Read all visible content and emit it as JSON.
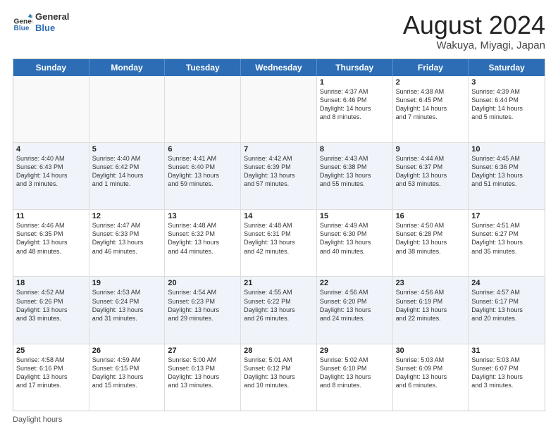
{
  "header": {
    "logo_line1": "General",
    "logo_line2": "Blue",
    "title": "August 2024",
    "subtitle": "Wakuya, Miyagi, Japan"
  },
  "days_of_week": [
    "Sunday",
    "Monday",
    "Tuesday",
    "Wednesday",
    "Thursday",
    "Friday",
    "Saturday"
  ],
  "weeks": [
    [
      {
        "day": "",
        "info": ""
      },
      {
        "day": "",
        "info": ""
      },
      {
        "day": "",
        "info": ""
      },
      {
        "day": "",
        "info": ""
      },
      {
        "day": "1",
        "info": "Sunrise: 4:37 AM\nSunset: 6:46 PM\nDaylight: 14 hours\nand 8 minutes."
      },
      {
        "day": "2",
        "info": "Sunrise: 4:38 AM\nSunset: 6:45 PM\nDaylight: 14 hours\nand 7 minutes."
      },
      {
        "day": "3",
        "info": "Sunrise: 4:39 AM\nSunset: 6:44 PM\nDaylight: 14 hours\nand 5 minutes."
      }
    ],
    [
      {
        "day": "4",
        "info": "Sunrise: 4:40 AM\nSunset: 6:43 PM\nDaylight: 14 hours\nand 3 minutes."
      },
      {
        "day": "5",
        "info": "Sunrise: 4:40 AM\nSunset: 6:42 PM\nDaylight: 14 hours\nand 1 minute."
      },
      {
        "day": "6",
        "info": "Sunrise: 4:41 AM\nSunset: 6:40 PM\nDaylight: 13 hours\nand 59 minutes."
      },
      {
        "day": "7",
        "info": "Sunrise: 4:42 AM\nSunset: 6:39 PM\nDaylight: 13 hours\nand 57 minutes."
      },
      {
        "day": "8",
        "info": "Sunrise: 4:43 AM\nSunset: 6:38 PM\nDaylight: 13 hours\nand 55 minutes."
      },
      {
        "day": "9",
        "info": "Sunrise: 4:44 AM\nSunset: 6:37 PM\nDaylight: 13 hours\nand 53 minutes."
      },
      {
        "day": "10",
        "info": "Sunrise: 4:45 AM\nSunset: 6:36 PM\nDaylight: 13 hours\nand 51 minutes."
      }
    ],
    [
      {
        "day": "11",
        "info": "Sunrise: 4:46 AM\nSunset: 6:35 PM\nDaylight: 13 hours\nand 48 minutes."
      },
      {
        "day": "12",
        "info": "Sunrise: 4:47 AM\nSunset: 6:33 PM\nDaylight: 13 hours\nand 46 minutes."
      },
      {
        "day": "13",
        "info": "Sunrise: 4:48 AM\nSunset: 6:32 PM\nDaylight: 13 hours\nand 44 minutes."
      },
      {
        "day": "14",
        "info": "Sunrise: 4:48 AM\nSunset: 6:31 PM\nDaylight: 13 hours\nand 42 minutes."
      },
      {
        "day": "15",
        "info": "Sunrise: 4:49 AM\nSunset: 6:30 PM\nDaylight: 13 hours\nand 40 minutes."
      },
      {
        "day": "16",
        "info": "Sunrise: 4:50 AM\nSunset: 6:28 PM\nDaylight: 13 hours\nand 38 minutes."
      },
      {
        "day": "17",
        "info": "Sunrise: 4:51 AM\nSunset: 6:27 PM\nDaylight: 13 hours\nand 35 minutes."
      }
    ],
    [
      {
        "day": "18",
        "info": "Sunrise: 4:52 AM\nSunset: 6:26 PM\nDaylight: 13 hours\nand 33 minutes."
      },
      {
        "day": "19",
        "info": "Sunrise: 4:53 AM\nSunset: 6:24 PM\nDaylight: 13 hours\nand 31 minutes."
      },
      {
        "day": "20",
        "info": "Sunrise: 4:54 AM\nSunset: 6:23 PM\nDaylight: 13 hours\nand 29 minutes."
      },
      {
        "day": "21",
        "info": "Sunrise: 4:55 AM\nSunset: 6:22 PM\nDaylight: 13 hours\nand 26 minutes."
      },
      {
        "day": "22",
        "info": "Sunrise: 4:56 AM\nSunset: 6:20 PM\nDaylight: 13 hours\nand 24 minutes."
      },
      {
        "day": "23",
        "info": "Sunrise: 4:56 AM\nSunset: 6:19 PM\nDaylight: 13 hours\nand 22 minutes."
      },
      {
        "day": "24",
        "info": "Sunrise: 4:57 AM\nSunset: 6:17 PM\nDaylight: 13 hours\nand 20 minutes."
      }
    ],
    [
      {
        "day": "25",
        "info": "Sunrise: 4:58 AM\nSunset: 6:16 PM\nDaylight: 13 hours\nand 17 minutes."
      },
      {
        "day": "26",
        "info": "Sunrise: 4:59 AM\nSunset: 6:15 PM\nDaylight: 13 hours\nand 15 minutes."
      },
      {
        "day": "27",
        "info": "Sunrise: 5:00 AM\nSunset: 6:13 PM\nDaylight: 13 hours\nand 13 minutes."
      },
      {
        "day": "28",
        "info": "Sunrise: 5:01 AM\nSunset: 6:12 PM\nDaylight: 13 hours\nand 10 minutes."
      },
      {
        "day": "29",
        "info": "Sunrise: 5:02 AM\nSunset: 6:10 PM\nDaylight: 13 hours\nand 8 minutes."
      },
      {
        "day": "30",
        "info": "Sunrise: 5:03 AM\nSunset: 6:09 PM\nDaylight: 13 hours\nand 6 minutes."
      },
      {
        "day": "31",
        "info": "Sunrise: 5:03 AM\nSunset: 6:07 PM\nDaylight: 13 hours\nand 3 minutes."
      }
    ]
  ],
  "footer": "Daylight hours",
  "accent_color": "#2d6db5"
}
